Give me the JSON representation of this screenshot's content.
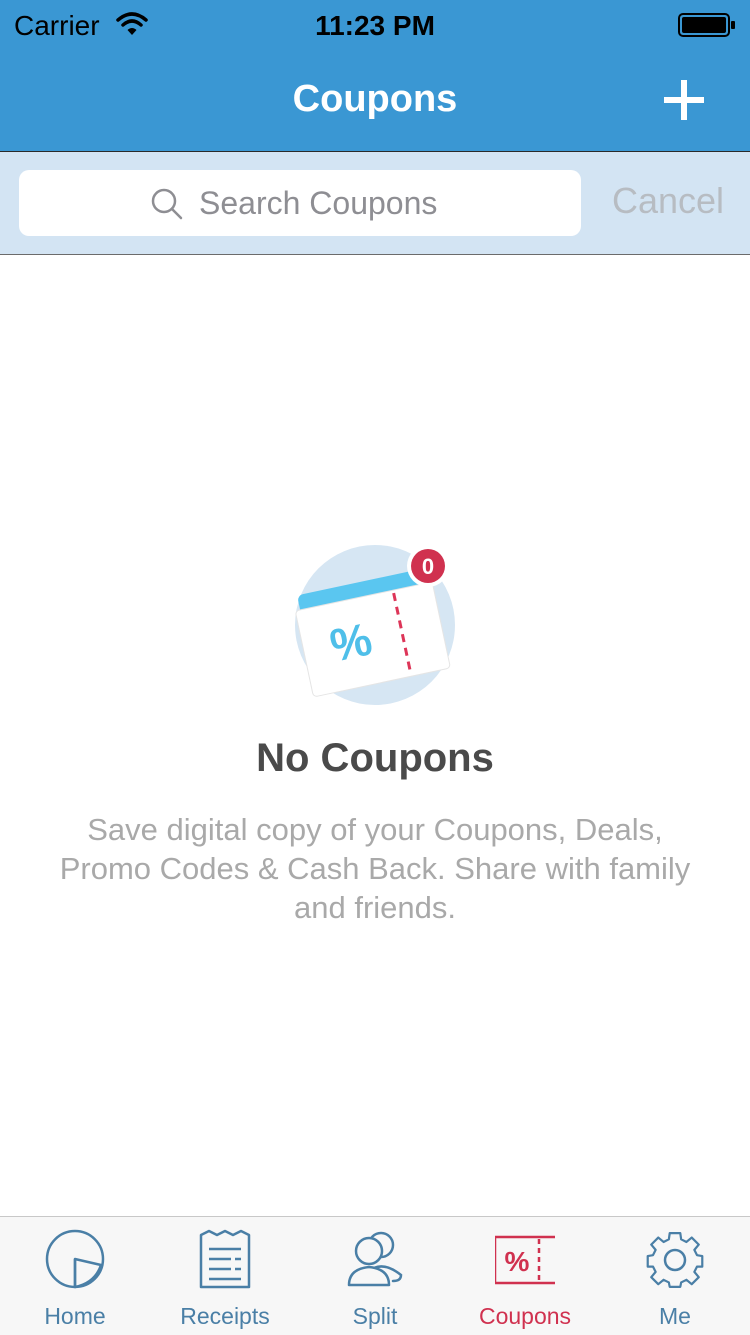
{
  "status_bar": {
    "carrier": "Carrier",
    "time": "11:23 PM"
  },
  "nav": {
    "title": "Coupons",
    "add_icon": "plus-icon"
  },
  "search": {
    "placeholder": "Search Coupons",
    "value": "",
    "cancel_label": "Cancel"
  },
  "empty_state": {
    "badge_count": "0",
    "coupon_symbol": "%",
    "title": "No Coupons",
    "description": "Save digital copy of your Coupons, Deals, Promo Codes & Cash Back. Share with family and friends."
  },
  "tabs": [
    {
      "label": "Home",
      "icon": "pie-chart-icon",
      "active": false
    },
    {
      "label": "Receipts",
      "icon": "receipt-icon",
      "active": false
    },
    {
      "label": "Split",
      "icon": "people-icon",
      "active": false
    },
    {
      "label": "Coupons",
      "icon": "coupon-icon",
      "active": true
    },
    {
      "label": "Me",
      "icon": "gear-icon",
      "active": false
    }
  ],
  "colors": {
    "accent": "#3a97d3",
    "search_bar_bg": "#d3e4f3",
    "tab_inactive": "#4a7fa6",
    "tab_active": "#d0314f"
  }
}
